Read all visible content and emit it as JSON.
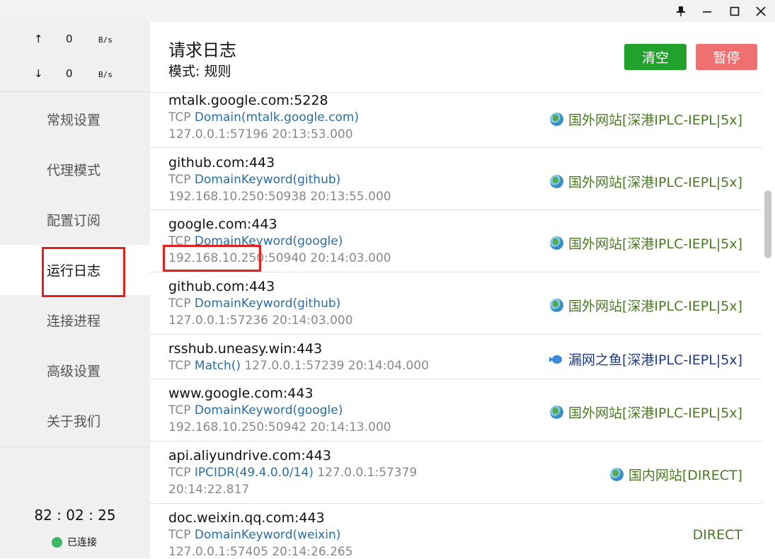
{
  "window": {
    "pin_icon": "pin-icon",
    "minimize_icon": "minimize-icon",
    "maximize_icon": "maximize-icon",
    "close_icon": "close-icon"
  },
  "traffic": {
    "up_arrow": "↑",
    "up_value": "0",
    "up_unit": "B/s",
    "down_arrow": "↓",
    "down_value": "0",
    "down_unit": "B/s"
  },
  "nav": [
    {
      "label": "常规设置"
    },
    {
      "label": "代理模式"
    },
    {
      "label": "配置订阅"
    },
    {
      "label": "运行日志"
    },
    {
      "label": "连接进程"
    },
    {
      "label": "高级设置"
    },
    {
      "label": "关于我们"
    }
  ],
  "status": {
    "uptime": "82 : 02 : 25",
    "connection": "已连接",
    "connection_color": "#3bb768"
  },
  "header": {
    "title": "请求日志",
    "mode": "模式: 规则",
    "clear_label": "清空",
    "pause_label": "暂停"
  },
  "logs": [
    {
      "host": "mtalk.google.com:5228",
      "proto": "TCP",
      "rule": "Domain(mtalk.google.com)",
      "source": "127.0.0.1:57196 20:13:53.000",
      "route": "国外网站[深港IPLC-IEPL|5x]",
      "route_icon": "globe-icon"
    },
    {
      "host": "github.com:443",
      "proto": "TCP",
      "rule": "DomainKeyword(github)",
      "source": "192.168.10.250:50938 20:13:55.000",
      "route": "国外网站[深港IPLC-IEPL|5x]",
      "route_icon": "globe-icon"
    },
    {
      "host": "google.com:443",
      "proto": "TCP",
      "rule": "DomainKeyword(google)",
      "source": "192.168.10.250:50940 20:14:03.000",
      "route": "国外网站[深港IPLC-IEPL|5x]",
      "route_icon": "globe-icon"
    },
    {
      "host": "github.com:443",
      "proto": "TCP",
      "rule": "DomainKeyword(github)",
      "source": "127.0.0.1:57236 20:14:03.000",
      "route": "国外网站[深港IPLC-IEPL|5x]",
      "route_icon": "globe-icon"
    },
    {
      "host": "rsshub.uneasy.win:443",
      "proto": "TCP",
      "rule": "Match()",
      "source": "127.0.0.1:57239 20:14:04.000",
      "route": "漏网之鱼[深港IPLC-IEPL|5x]",
      "route_icon": "fish-icon"
    },
    {
      "host": "www.google.com:443",
      "proto": "TCP",
      "rule": "DomainKeyword(google)",
      "source": "192.168.10.250:50942 20:14:13.000",
      "route": "国外网站[深港IPLC-IEPL|5x]",
      "route_icon": "globe-icon"
    },
    {
      "host": "api.aliyundrive.com:443",
      "proto": "TCP",
      "rule": "IPCIDR(49.4.0.0/14)",
      "source": "127.0.0.1:57379",
      "source2": "20:14:22.817",
      "route": "国内网站[DIRECT]",
      "route_icon": "globe-icon"
    },
    {
      "host": "doc.weixin.qq.com:443",
      "proto": "TCP",
      "rule": "DomainKeyword(weixin)",
      "source": "127.0.0.1:57405 20:14:26.265",
      "route": "DIRECT"
    }
  ],
  "colors": {
    "accent_green": "#23a12d",
    "pause_red": "#f07070",
    "rule_blue": "#2a6e9e",
    "route_green": "#4a7a22",
    "highlight_red": "#e0201e"
  }
}
